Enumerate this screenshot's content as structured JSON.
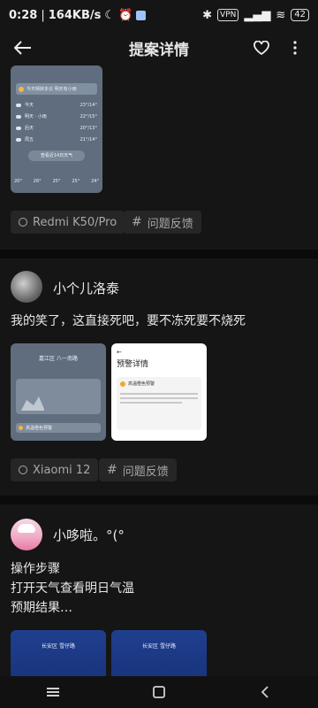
{
  "status_bar": {
    "time": "0:28",
    "speed": "164KB/s",
    "vpn": "VPN",
    "battery": "42"
  },
  "app_bar": {
    "title": "提案详情"
  },
  "post1": {
    "weather_top_text": "今天晴转多云  明天有小雨",
    "weather_rows": [
      {
        "label": "今天",
        "temp": "23°/14°"
      },
      {
        "label": "明天 · 小雨",
        "temp": "22°/15°"
      },
      {
        "label": "后天",
        "temp": "20°/13°"
      },
      {
        "label": "周五",
        "temp": "21°/14°"
      }
    ],
    "weather_button": "查看近14日天气",
    "weather_bottom_temps": [
      "20°",
      "26°",
      "25°",
      "25°",
      "24°"
    ],
    "tag": "Redmi K50/Pro",
    "category": "问题反馈"
  },
  "post2": {
    "username": "小个儿洛泰",
    "text": "我的笑了，这直接死吧，要不冻死要不烧死",
    "screen_left_title": "嘉江区 八一南路",
    "screen_left_sub": "高温橙色预警",
    "screen_right_title": "预警详情",
    "screen_right_alert": "高温橙色预警",
    "tag": "Xiaomi 12",
    "category": "问题反馈"
  },
  "post3": {
    "username": "小哆啦。°(°",
    "lines": [
      "操作步骤",
      "打开天气查看明日气温",
      "预期结果…"
    ],
    "screen_left_title": "长安区 雪仔路",
    "screen_right_title": "长安区 雪仔路"
  },
  "colors": {
    "background": "#151515",
    "card": "#262626",
    "weather_screen": "#5f6d7e"
  }
}
